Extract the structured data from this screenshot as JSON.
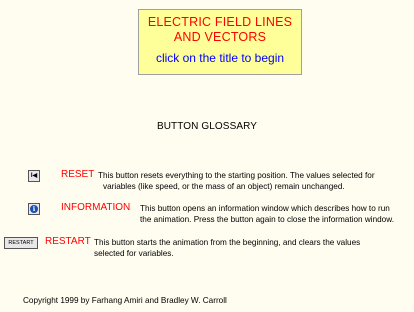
{
  "title": {
    "line1": "ELECTRIC FIELD LINES",
    "line2": "AND VECTORS",
    "link": "click on the title to begin"
  },
  "glossary_heading": "BUTTON GLOSSARY",
  "buttons": [
    {
      "icon_label": "I◀",
      "icon": "reset-icon",
      "label": "RESET",
      "desc_line1": "This button resets everything to the starting position.  The values selected for",
      "desc_line2": "variables (like speed, or the mass of an object) remain unchanged."
    },
    {
      "icon_label": "i",
      "icon": "info-icon",
      "label": "INFORMATION",
      "desc_line1": "This button opens an information window which describes how to run",
      "desc_line2": "the animation.  Press the button again to close the information window."
    },
    {
      "icon_label": "RESTART",
      "icon": "restart-icon",
      "label": "RESTART",
      "desc_line1": "This button starts the animation from the beginning, and clears the values",
      "desc_line2": "selected for variables."
    }
  ],
  "copyright": "Copyright 1999 by Farhang Amiri and Bradley W. Carroll",
  "colors": {
    "background": "#fffdf0",
    "title_box": "#ffff99",
    "title_text": "#ff0000",
    "link_text": "#0000ff",
    "label_text": "#ff0000"
  }
}
